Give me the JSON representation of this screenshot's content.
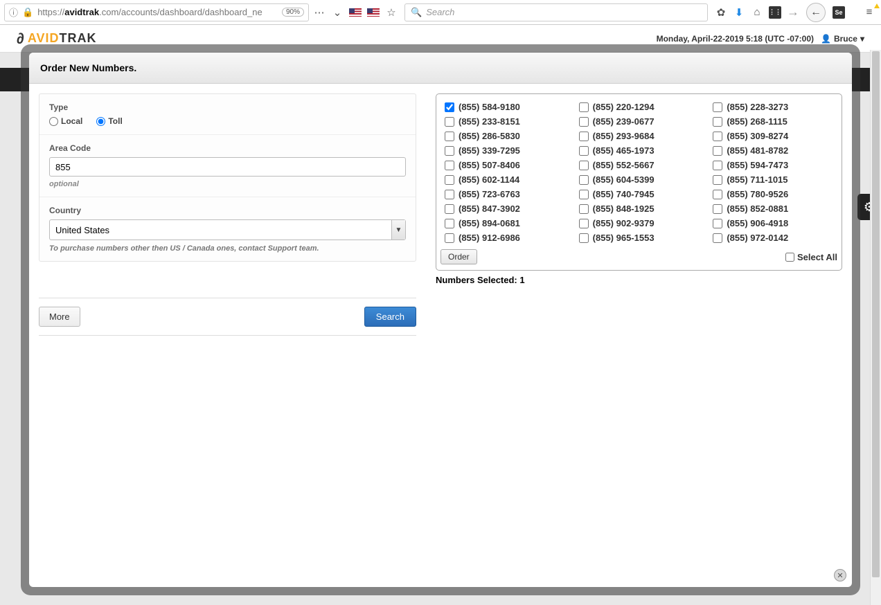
{
  "url": {
    "prefix": "https://",
    "host": "avidtrak",
    "suffix": ".com/accounts/dashboard/dashboard_ne",
    "zoom": "90%"
  },
  "search_placeholder": "Search",
  "header": {
    "brand1": "AVID",
    "brand2": "TRAK",
    "datetime": "Monday, April-22-2019 5:18 (UTC -07:00)",
    "user": "Bruce"
  },
  "modal": {
    "title": "Order New Numbers.",
    "type_label": "Type",
    "type_options": {
      "local": "Local",
      "toll": "Toll"
    },
    "type_selected": "toll",
    "area_code_label": "Area Code",
    "area_code_value": "855",
    "area_code_hint": "optional",
    "country_label": "Country",
    "country_value": "United States",
    "country_note": "To purchase numbers other then US / Canada ones, contact Support team.",
    "btn_more": "More",
    "btn_search": "Search",
    "btn_order": "Order",
    "select_all": "Select All",
    "selected_label": "Numbers Selected:",
    "selected_count": "1"
  },
  "numbers": [
    {
      "n": "(855) 584-9180",
      "checked": true
    },
    {
      "n": "(855) 220-1294",
      "checked": false
    },
    {
      "n": "(855) 228-3273",
      "checked": false
    },
    {
      "n": "(855) 233-8151",
      "checked": false
    },
    {
      "n": "(855) 239-0677",
      "checked": false
    },
    {
      "n": "(855) 268-1115",
      "checked": false
    },
    {
      "n": "(855) 286-5830",
      "checked": false
    },
    {
      "n": "(855) 293-9684",
      "checked": false
    },
    {
      "n": "(855) 309-8274",
      "checked": false
    },
    {
      "n": "(855) 339-7295",
      "checked": false
    },
    {
      "n": "(855) 465-1973",
      "checked": false
    },
    {
      "n": "(855) 481-8782",
      "checked": false
    },
    {
      "n": "(855) 507-8406",
      "checked": false
    },
    {
      "n": "(855) 552-5667",
      "checked": false
    },
    {
      "n": "(855) 594-7473",
      "checked": false
    },
    {
      "n": "(855) 602-1144",
      "checked": false
    },
    {
      "n": "(855) 604-5399",
      "checked": false
    },
    {
      "n": "(855) 711-1015",
      "checked": false
    },
    {
      "n": "(855) 723-6763",
      "checked": false
    },
    {
      "n": "(855) 740-7945",
      "checked": false
    },
    {
      "n": "(855) 780-9526",
      "checked": false
    },
    {
      "n": "(855) 847-3902",
      "checked": false
    },
    {
      "n": "(855) 848-1925",
      "checked": false
    },
    {
      "n": "(855) 852-0881",
      "checked": false
    },
    {
      "n": "(855) 894-0681",
      "checked": false
    },
    {
      "n": "(855) 902-9379",
      "checked": false
    },
    {
      "n": "(855) 906-4918",
      "checked": false
    },
    {
      "n": "(855) 912-6986",
      "checked": false
    },
    {
      "n": "(855) 965-1553",
      "checked": false
    },
    {
      "n": "(855) 972-0142",
      "checked": false
    }
  ]
}
